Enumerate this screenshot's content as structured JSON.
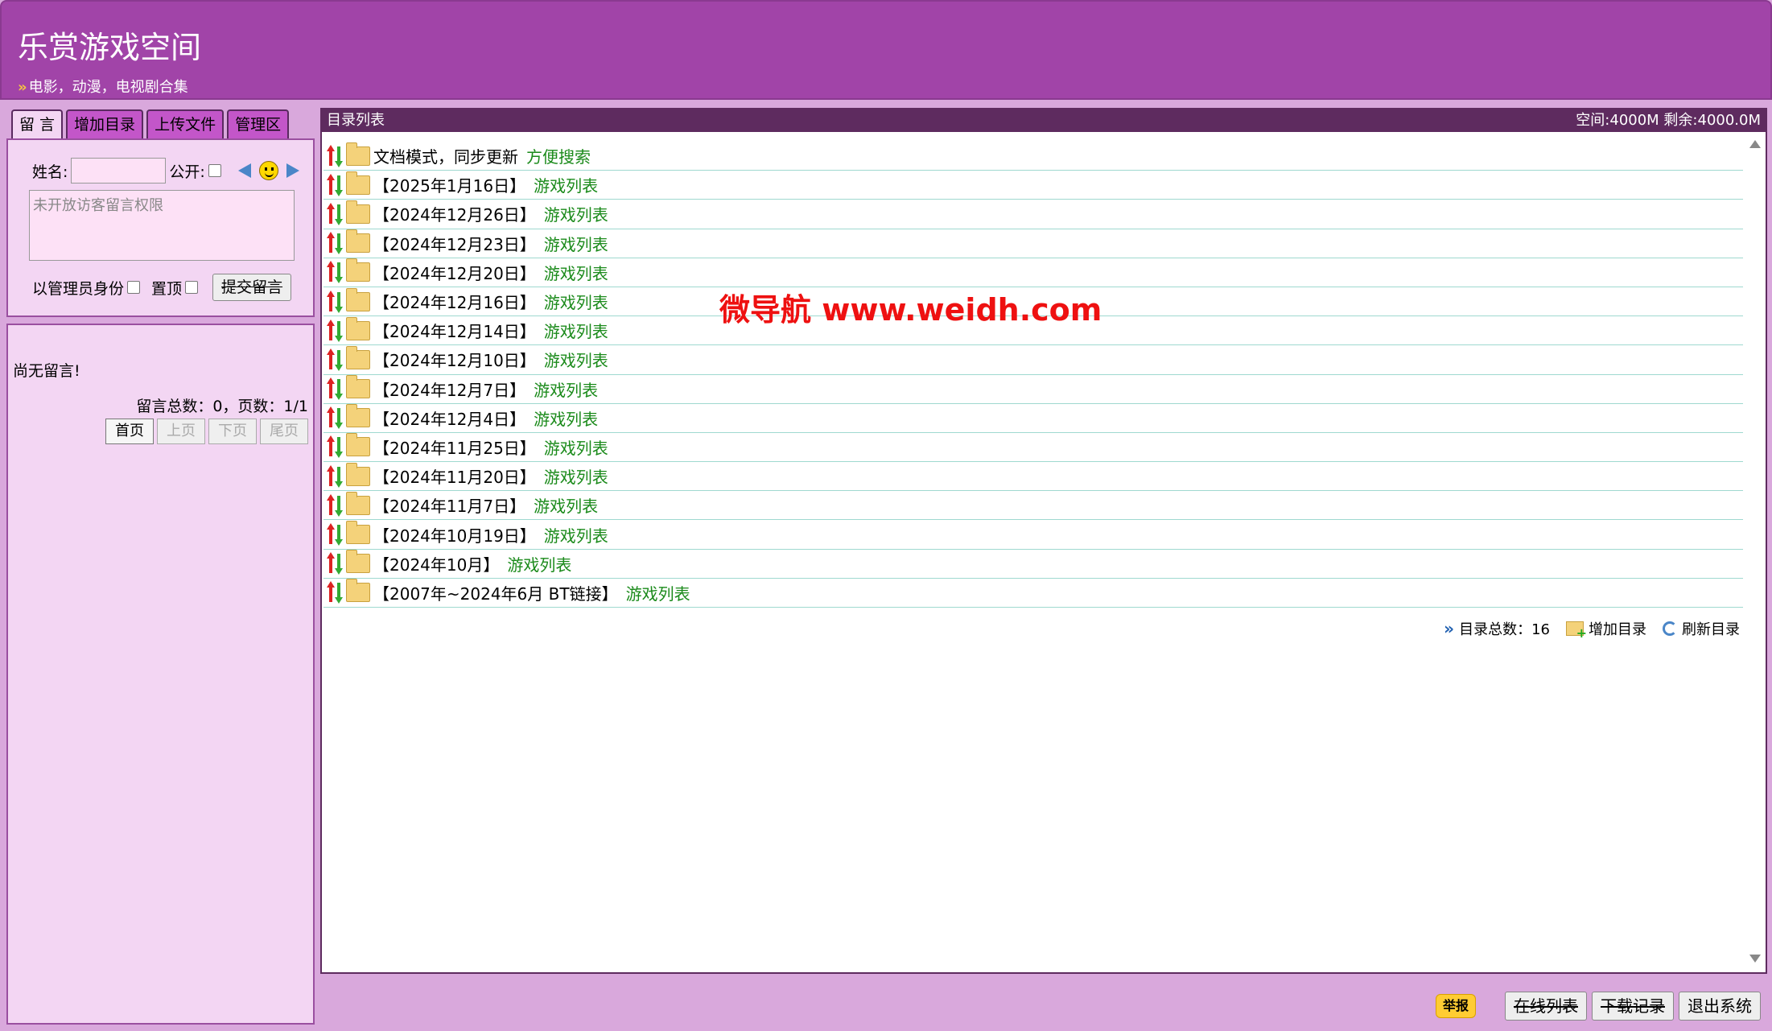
{
  "header": {
    "title": "乐赏游戏空间",
    "subtitle_arrow": "»",
    "subtitle": "电影，动漫，电视剧合集"
  },
  "tabs": [
    {
      "label": "留 言"
    },
    {
      "label": "增加目录"
    },
    {
      "label": "上传文件"
    },
    {
      "label": "管理区"
    }
  ],
  "message_form": {
    "name_label": "姓名:",
    "name_value": "",
    "public_label": "公开:",
    "textarea_placeholder": "未开放访客留言权限",
    "admin_label": "以管理员身份",
    "top_label": "置顶",
    "submit_label": "提交留言"
  },
  "message_list": {
    "empty_text": "尚无留言!",
    "stats": "留言总数：0，页数：1/1",
    "pager": [
      "首页",
      "上页",
      "下页",
      "尾页"
    ]
  },
  "directory": {
    "header_title": "目录列表",
    "space_info": "空间:4000M 剩余:4000.0M",
    "rows": [
      {
        "name": "文档模式，同步更新",
        "link": "方便搜索"
      },
      {
        "name": "【2025年1月16日】",
        "link": "游戏列表"
      },
      {
        "name": "【2024年12月26日】",
        "link": "游戏列表"
      },
      {
        "name": "【2024年12月23日】",
        "link": "游戏列表"
      },
      {
        "name": "【2024年12月20日】",
        "link": "游戏列表"
      },
      {
        "name": "【2024年12月16日】",
        "link": "游戏列表"
      },
      {
        "name": "【2024年12月14日】",
        "link": "游戏列表"
      },
      {
        "name": "【2024年12月10日】",
        "link": "游戏列表"
      },
      {
        "name": "【2024年12月7日】",
        "link": "游戏列表"
      },
      {
        "name": "【2024年12月4日】",
        "link": "游戏列表"
      },
      {
        "name": "【2024年11月25日】",
        "link": "游戏列表"
      },
      {
        "name": "【2024年11月20日】",
        "link": "游戏列表"
      },
      {
        "name": "【2024年11月7日】",
        "link": "游戏列表"
      },
      {
        "name": "【2024年10月19日】",
        "link": "游戏列表"
      },
      {
        "name": "【2024年10月】",
        "link": "游戏列表"
      },
      {
        "name": "【2007年~2024年6月 BT链接】",
        "link": "游戏列表"
      }
    ],
    "footer": {
      "total_label": "目录总数：16",
      "add_label": "增加目录",
      "refresh_label": "刷新目录"
    }
  },
  "watermark": "微导航 www.weidh.com",
  "bottom_bar": {
    "report": "举报",
    "online_list": "在线列表",
    "download_log": "下载记录",
    "logout": "退出系统"
  }
}
